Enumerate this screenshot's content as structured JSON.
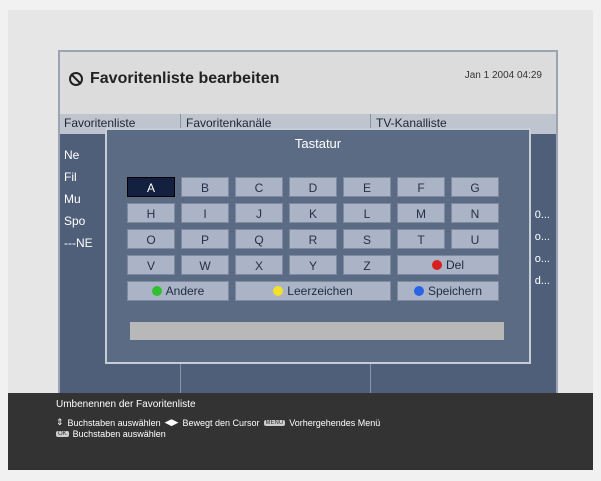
{
  "header": {
    "title": "Favoritenliste bearbeiten",
    "datetime": "Jan 1 2004 04:29"
  },
  "columns": [
    "Favoritenliste",
    "Favoritenkanäle",
    "TV-Kanalliste"
  ],
  "left_list": [
    "Ne",
    "Fil",
    "Mu",
    "Spo",
    "---NE"
  ],
  "right_list": [
    "0...",
    "o...",
    "o...",
    "d..."
  ],
  "keyboard": {
    "title": "Tastatur",
    "rows": [
      [
        "A",
        "B",
        "C",
        "D",
        "E",
        "F",
        "G"
      ],
      [
        "H",
        "I",
        "J",
        "K",
        "L",
        "M",
        "N"
      ],
      [
        "O",
        "P",
        "Q",
        "R",
        "S",
        "T",
        "U"
      ],
      [
        "V",
        "W",
        "X",
        "Y",
        "Z"
      ]
    ],
    "selected": "A",
    "del_label": "Del",
    "andere_label": "Andere",
    "leer_label": "Leerzeichen",
    "speichern_label": "Speichern",
    "colors": {
      "red": "#d91f1f",
      "green": "#2fbf2f",
      "yellow": "#f4df2a",
      "blue": "#2a63e6"
    }
  },
  "status": {
    "line1": "Umbenennen der Favoritenliste",
    "line2a": "Buchstaben auswählen",
    "line2b": "Bewegt den Cursor",
    "line2c": "Vorhergehendes Menü",
    "line3": "Buchstaben auswählen",
    "key_menu": "MENU",
    "key_ok": "OK"
  }
}
